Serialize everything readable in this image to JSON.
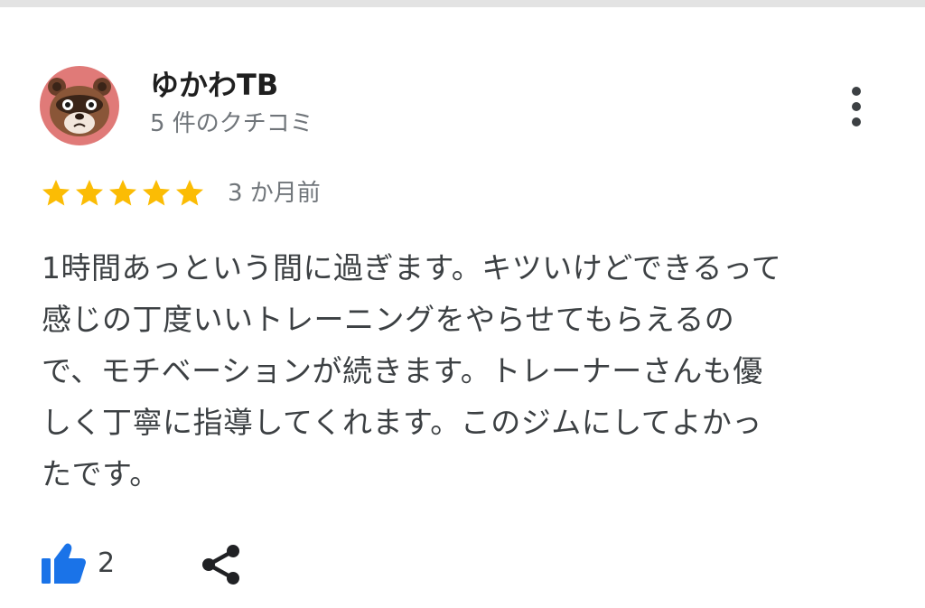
{
  "review": {
    "reviewer_name": "ゆかわTB",
    "review_count": "5 件のクチコミ",
    "rating": 5,
    "rating_max": 5,
    "time_ago": "3 か月前",
    "text": "1時間あっという間に過ぎます。キツいけどできるって\n感じの丁度いいトレーニングをやらせてもらえるの\nで、モチベーションが続きます。トレーナーさんも優\nしく丁寧に指導してくれます。このジムにしてよかっ\nたです。",
    "like_count": "2"
  },
  "icons": {
    "avatar": "raccoon-dog-avatar",
    "more": "more-vert-icon",
    "star": "star-icon",
    "like": "thumbs-up-icon",
    "share": "share-icon"
  },
  "colors": {
    "star": "#FBBC04",
    "like": "#1a73e8",
    "avatar_bg": "#e07a78",
    "secondary_text": "#70757a"
  }
}
